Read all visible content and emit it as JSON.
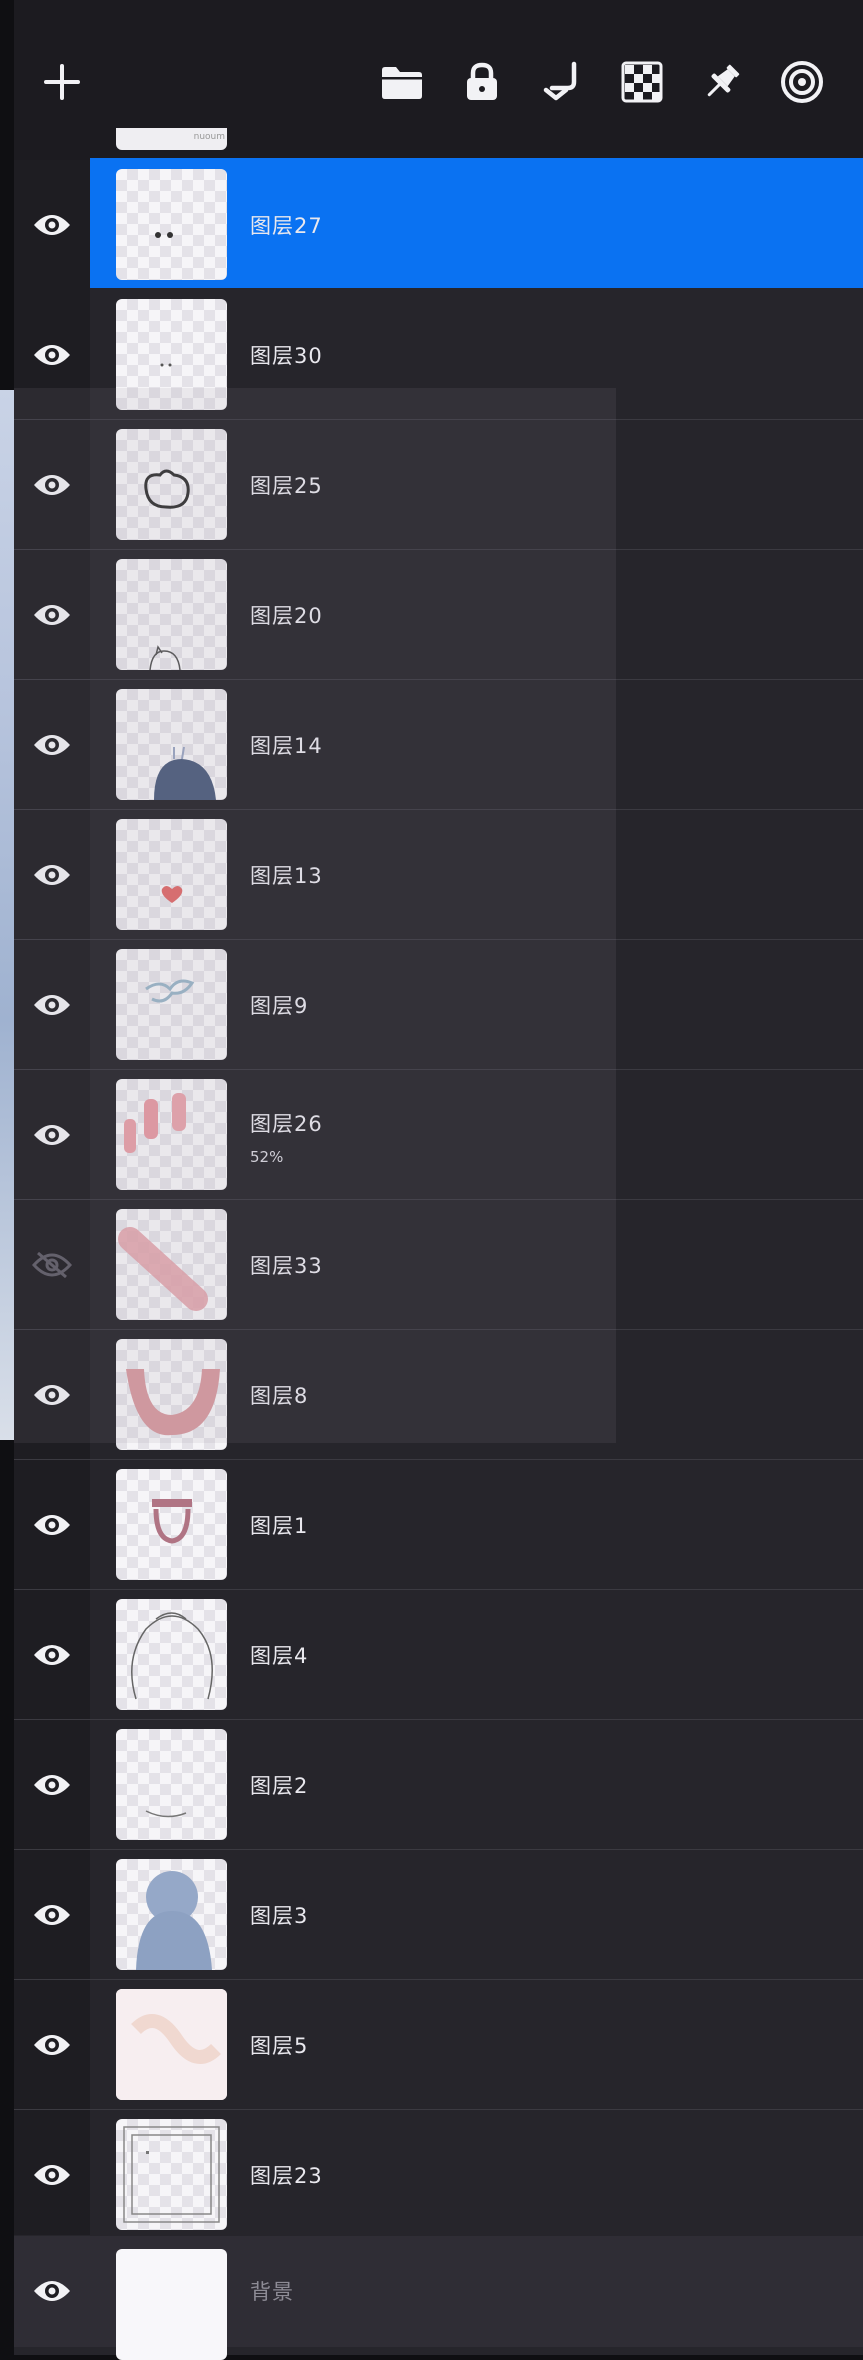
{
  "toolbar": {
    "icons": [
      "add-icon",
      "folder-icon",
      "lock-icon",
      "merge-down-icon",
      "checker-icon",
      "pin-icon",
      "target-icon"
    ],
    "clipped_label": "nuoum"
  },
  "layers": [
    {
      "name": "图层27",
      "opacity": "",
      "visible": true,
      "selected": true
    },
    {
      "name": "图层30",
      "opacity": "",
      "visible": true,
      "selected": false
    },
    {
      "name": "图层25",
      "opacity": "",
      "visible": true,
      "selected": false
    },
    {
      "name": "图层20",
      "opacity": "",
      "visible": true,
      "selected": false
    },
    {
      "name": "图层14",
      "opacity": "",
      "visible": true,
      "selected": false
    },
    {
      "name": "图层13",
      "opacity": "",
      "visible": true,
      "selected": false
    },
    {
      "name": "图层9",
      "opacity": "",
      "visible": true,
      "selected": false
    },
    {
      "name": "图层26",
      "opacity": "52%",
      "visible": true,
      "selected": false
    },
    {
      "name": "图层33",
      "opacity": "",
      "visible": false,
      "selected": false
    },
    {
      "name": "图层8",
      "opacity": "",
      "visible": true,
      "selected": false
    },
    {
      "name": "图层1",
      "opacity": "",
      "visible": true,
      "selected": false
    },
    {
      "name": "图层4",
      "opacity": "",
      "visible": true,
      "selected": false
    },
    {
      "name": "图层2",
      "opacity": "",
      "visible": true,
      "selected": false
    },
    {
      "name": "图层3",
      "opacity": "",
      "visible": true,
      "selected": false
    },
    {
      "name": "图层5",
      "opacity": "",
      "visible": true,
      "selected": false
    },
    {
      "name": "图层23",
      "opacity": "",
      "visible": true,
      "selected": false
    }
  ],
  "background_layer": {
    "name": "背景",
    "visible": true
  },
  "colors": {
    "selected": "#0a72f2",
    "panel": "#26252b",
    "text": "#e9e8ee"
  }
}
